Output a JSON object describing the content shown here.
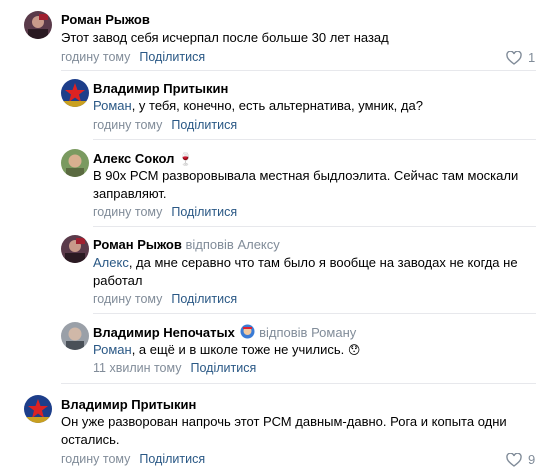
{
  "comments": [
    {
      "author": "Роман Рыжов",
      "text": "Этот завод себя исчерпал после больше 30 лет назад",
      "time": "годину тому",
      "share": "Поділитися",
      "likes": "1"
    },
    {
      "author": "Владимир Притыкин",
      "mention": "Роман",
      "text": ", у тебя, конечно, есть альтернатива, умник, да?",
      "time": "годину тому",
      "share": "Поділитися"
    },
    {
      "author": "Алекс Сокол",
      "badge": "🍷",
      "text_line1": "В 90х РСМ разворовывала местная быдлоэлита. Сейчас там москали",
      "text_line2": "заправляют.",
      "time": "годину тому",
      "share": "Поділитися"
    },
    {
      "author": "Роман Рыжов",
      "reply_to": "відповів Алексу",
      "mention": "Алекс",
      "text_line1": ", да мне серавно что там было я вообще на заводах не когда не",
      "text_line2": "работал",
      "time": "годину тому",
      "share": "Поділитися"
    },
    {
      "author": "Владимир Непочатых",
      "reply_to": "відповів Роману",
      "mention": "Роман",
      "text": ", а ещё и в школе тоже не учились.",
      "emoji": "😯",
      "time": "11 хвилин тому",
      "share": "Поділитися"
    },
    {
      "author": "Владимир Притыкин",
      "text_line1": "Он уже разворован напрочь этот РСМ давным-давно. Рога и копыта одни",
      "text_line2": "остались.",
      "time": "годину тому",
      "share": "Поділитися",
      "likes": "9"
    }
  ],
  "colors": {
    "link": "#2a5885",
    "muted": "#818c99",
    "divider": "#e7e8ec"
  }
}
